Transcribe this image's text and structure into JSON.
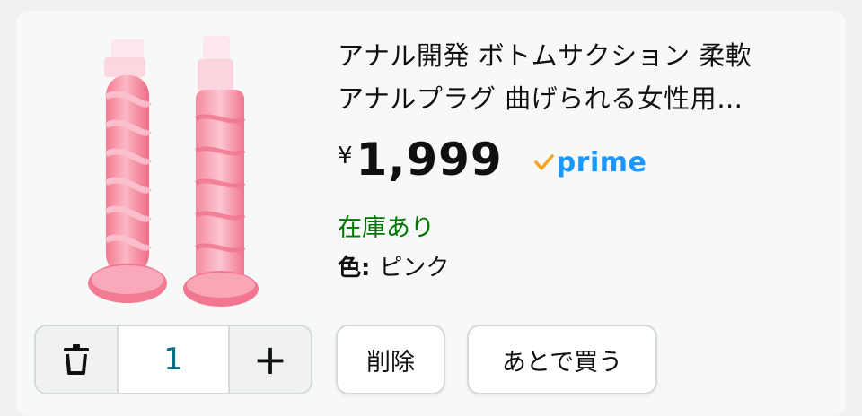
{
  "product": {
    "title_lines": [
      "アナル開発 ボトムサクション 柔軟",
      "アナルプラグ 曲げられる女性用…"
    ],
    "currency_symbol": "¥",
    "price": "1,999",
    "prime_label": "prime",
    "stock_status": "在庫あり",
    "variant_key": "色:",
    "variant_value": "ピンク",
    "image_icon": "product-image"
  },
  "quantity": {
    "value": "1",
    "decrease_icon": "trash-icon",
    "increase_symbol": "+"
  },
  "actions": {
    "delete_label": "削除",
    "save_for_later_label": "あとで買う"
  },
  "colors": {
    "price_text": "#0f1111",
    "prime_blue": "#1a98ff",
    "prime_check": "#f7a41d",
    "in_stock": "#007600",
    "quantity_value": "#007185"
  }
}
